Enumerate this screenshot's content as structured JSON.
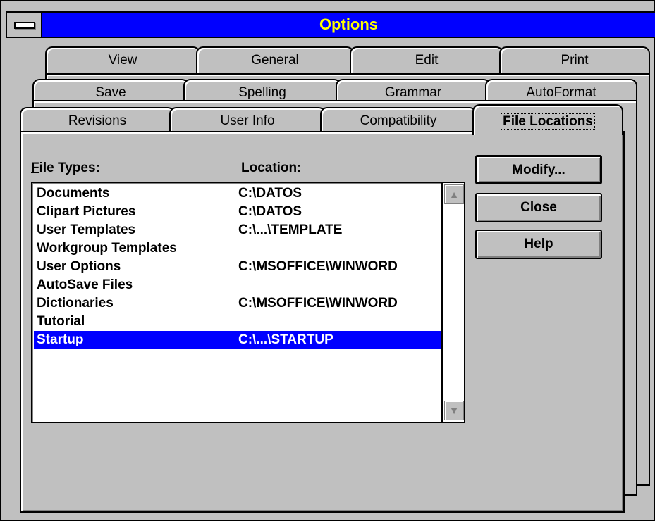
{
  "window": {
    "title": "Options"
  },
  "tabs": {
    "row1": [
      {
        "label": "View"
      },
      {
        "label": "General"
      },
      {
        "label": "Edit"
      },
      {
        "label": "Print"
      }
    ],
    "row2": [
      {
        "label": "Save"
      },
      {
        "label": "Spelling"
      },
      {
        "label": "Grammar"
      },
      {
        "label": "AutoFormat"
      }
    ],
    "row3": [
      {
        "label": "Revisions"
      },
      {
        "label": "User Info"
      },
      {
        "label": "Compatibility"
      },
      {
        "label": "File Locations"
      }
    ],
    "active": "File Locations"
  },
  "panel": {
    "file_types_header_first": "F",
    "file_types_header_rest": "ile Types:",
    "location_header": "Location:",
    "rows": [
      {
        "type": "Documents",
        "location": "C:\\DATOS"
      },
      {
        "type": "Clipart Pictures",
        "location": "C:\\DATOS"
      },
      {
        "type": "User Templates",
        "location": "C:\\...\\TEMPLATE"
      },
      {
        "type": "Workgroup Templates",
        "location": ""
      },
      {
        "type": "User Options",
        "location": "C:\\MSOFFICE\\WINWORD"
      },
      {
        "type": "AutoSave Files",
        "location": ""
      },
      {
        "type": "Dictionaries",
        "location": "C:\\MSOFFICE\\WINWORD"
      },
      {
        "type": "Tutorial",
        "location": ""
      },
      {
        "type": "Startup",
        "location": "C:\\...\\STARTUP"
      }
    ],
    "selected_row": "Startup"
  },
  "buttons": {
    "modify_first": "M",
    "modify_rest": "odify...",
    "close": "Close",
    "help_first": "H",
    "help_rest": "elp"
  },
  "icons": {
    "system_menu": "system-menu-icon",
    "scroll_up": "up-arrow-icon",
    "scroll_down": "down-arrow-icon"
  }
}
